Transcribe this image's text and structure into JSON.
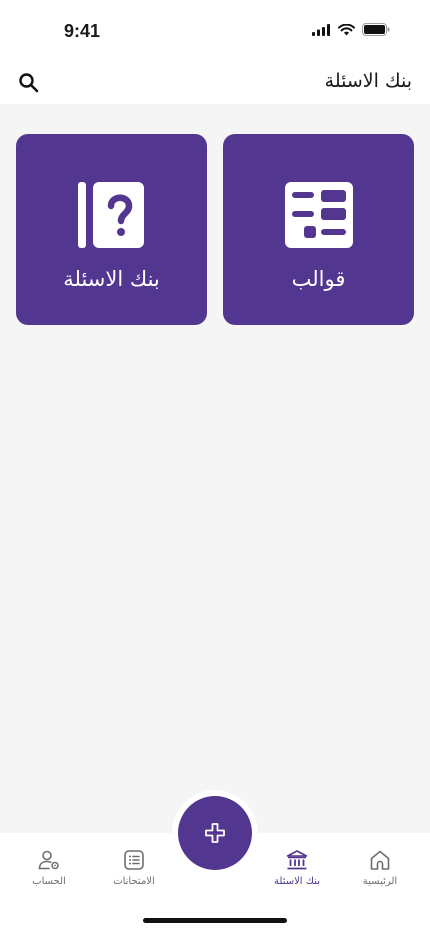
{
  "status_bar": {
    "time": "9:41"
  },
  "header": {
    "title": "بنك الاسئلة",
    "search_icon": "search-icon"
  },
  "cards": {
    "templates": {
      "label": "قوالب",
      "icon": "templates-icon"
    },
    "question_bank": {
      "label": "بنك الاسئلة",
      "icon": "question-book-icon"
    }
  },
  "bottom_nav": {
    "items": [
      {
        "label": "الرئيسية",
        "icon": "home-icon",
        "active": false
      },
      {
        "label": "بنك الاسئلة",
        "icon": "bank-icon",
        "active": true
      },
      {
        "label": "الامتحانات",
        "icon": "list-icon",
        "active": false
      },
      {
        "label": "الحساب",
        "icon": "user-settings-icon",
        "active": false
      }
    ],
    "fab_icon": "plus-icon"
  },
  "colors": {
    "accent": "#52368f",
    "background": "#f5f5f5",
    "inactive": "#6e6e6e"
  }
}
